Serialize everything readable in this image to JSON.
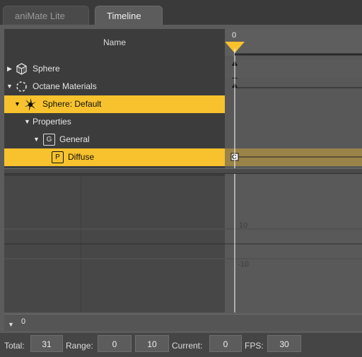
{
  "tabs": [
    {
      "label": "aniMate Lite"
    },
    {
      "label": "Timeline"
    }
  ],
  "tree": {
    "header": "Name",
    "rows": [
      {
        "label": "Sphere",
        "icon": "cube-icon"
      },
      {
        "label": "Octane Materials",
        "icon": "dashed-circle-icon"
      },
      {
        "label": "Sphere: Default",
        "icon": "octane-logo-icon"
      },
      {
        "label": "Properties"
      },
      {
        "label": "General",
        "icon_letter": "G"
      },
      {
        "label": "Diffuse",
        "icon_letter": "P"
      }
    ]
  },
  "timeline": {
    "frame_label": "0",
    "key_marker": "C"
  },
  "graph": {
    "y_labels": [
      "10",
      "-10"
    ]
  },
  "scrub": {
    "value": "0"
  },
  "status": {
    "total_label": "Total:",
    "total_value": "31",
    "range_label": "Range:",
    "range_start": "0",
    "range_end": "10",
    "current_label": "Current:",
    "current_value": "0",
    "fps_label": "FPS:",
    "fps_value": "30"
  },
  "colors": {
    "selection": "#f7c22d",
    "playhead": "#f7c22d",
    "selected_track": "#9a8348"
  }
}
